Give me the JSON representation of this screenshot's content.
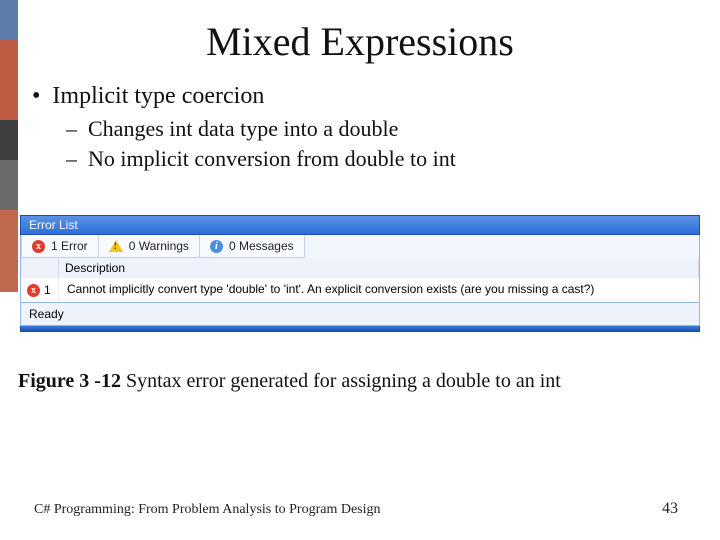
{
  "title": "Mixed Expressions",
  "bullets": {
    "l1": "Implicit type coercion",
    "l2a": "Changes int data type into a double",
    "l2b": "No implicit conversion from double to int"
  },
  "errorlist": {
    "titlebar": "Error List",
    "tabs": {
      "errors": "1 Error",
      "warnings": "0 Warnings",
      "messages": "0 Messages"
    },
    "header": {
      "description": "Description"
    },
    "row": {
      "index": "1",
      "message": "Cannot implicitly convert type 'double' to 'int'. An explicit conversion exists (are you missing a cast?)"
    },
    "status": "Ready"
  },
  "caption": {
    "label": "Figure 3 -12",
    "text": " Syntax error generated for assigning a double to an int"
  },
  "footer": {
    "book": "C# Programming: From Problem Analysis to Program Design",
    "page": "43"
  }
}
